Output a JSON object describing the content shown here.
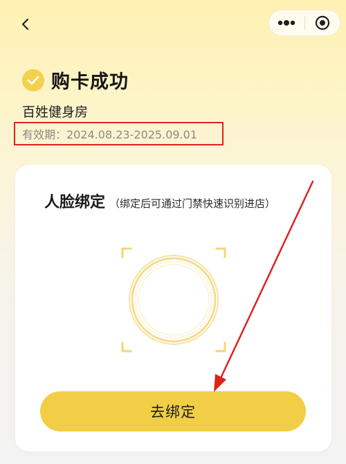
{
  "nav": {
    "back_icon": "chevron-left-icon",
    "more_icon": "more-dots-icon",
    "close_icon": "target-close-icon"
  },
  "status": {
    "title": "购卡成功",
    "check_icon": "check-circle-icon",
    "accent_color": "#f3d14d"
  },
  "gym": {
    "name": "百姓健身房"
  },
  "validity": {
    "text": "有效期：2024.08.23-2025.09.01",
    "highlight_color": "#e0211f"
  },
  "face_bind": {
    "title": "人脸绑定",
    "note": "（绑定后可通过门禁快速识别进店）",
    "frame_icon": "face-scan-frame-icon",
    "button_label": "去绑定",
    "button_color": "#f2ce46"
  },
  "annotation": {
    "arrow_color": "#e0211f"
  }
}
